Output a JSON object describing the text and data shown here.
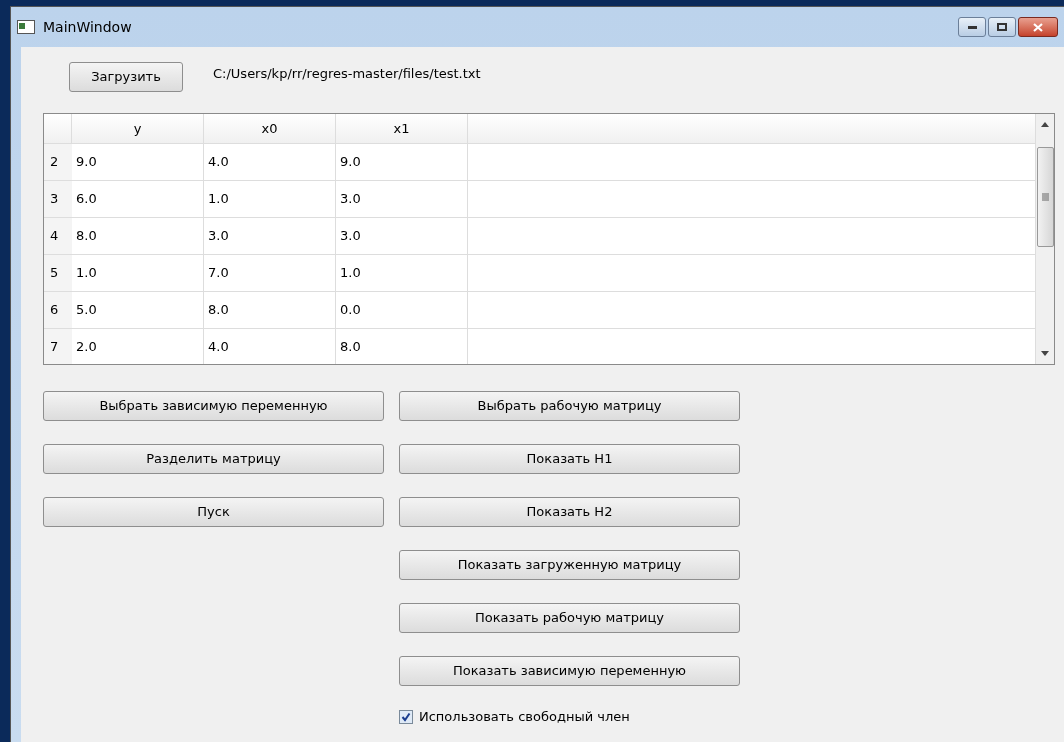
{
  "window": {
    "title": "MainWindow"
  },
  "load_button": "Загрузить",
  "file_path": "C:/Users/kp/rr/regres-master/files/test.txt",
  "table": {
    "columns": [
      "y",
      "x0",
      "x1"
    ],
    "rows": [
      {
        "header": "2",
        "cells": [
          "9.0",
          "4.0",
          "9.0"
        ]
      },
      {
        "header": "3",
        "cells": [
          "6.0",
          "1.0",
          "3.0"
        ]
      },
      {
        "header": "4",
        "cells": [
          "8.0",
          "3.0",
          "3.0"
        ]
      },
      {
        "header": "5",
        "cells": [
          "1.0",
          "7.0",
          "1.0"
        ]
      },
      {
        "header": "6",
        "cells": [
          "5.0",
          "8.0",
          "0.0"
        ]
      },
      {
        "header": "7",
        "cells": [
          "2.0",
          "4.0",
          "8.0"
        ]
      }
    ]
  },
  "left_buttons": [
    "Выбрать зависимую переменную",
    "Разделить матрицу",
    "Пуск"
  ],
  "right_buttons": [
    "Выбрать рабочую матрицу",
    "Показать H1",
    "Показать H2",
    "Показать загруженную матрицу",
    "Показать рабочую матрицу",
    "Показать зависимую переменную"
  ],
  "checkbox": {
    "label": "Использовать свободный член",
    "checked": true
  }
}
